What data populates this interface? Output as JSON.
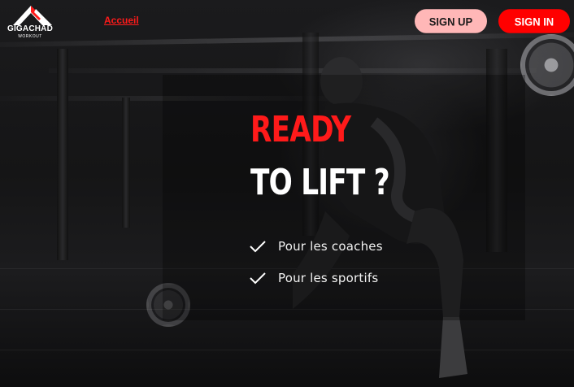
{
  "brand": {
    "name": "GIGACHAD",
    "tagline": "WORKOUT"
  },
  "nav": {
    "home_label": "Accueil"
  },
  "auth": {
    "signup_label": "SIGN UP",
    "signin_label": "SIGN IN"
  },
  "hero": {
    "line1": "READY",
    "line2": "TO LIFT ?",
    "features": [
      {
        "label": "Pour les coaches"
      },
      {
        "label": "Pour les sportifs"
      }
    ]
  },
  "colors": {
    "accent": "#ff1a1a",
    "signup_bg": "#ffb7b7",
    "signin_bg": "#ff0000"
  },
  "icons": {
    "logo": "mountain-peak-icon",
    "feature_bullet": "check-icon"
  }
}
